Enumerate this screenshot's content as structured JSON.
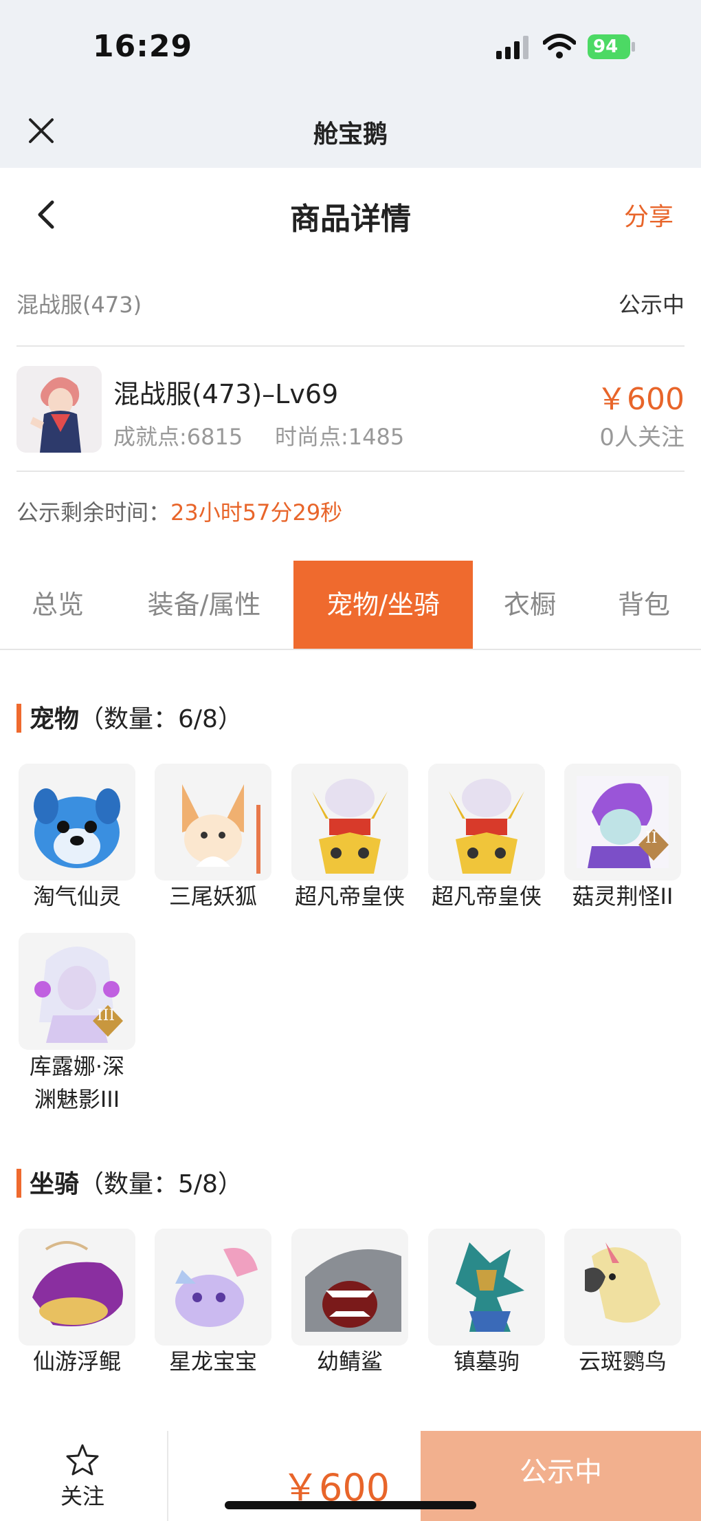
{
  "status_bar": {
    "time": "16:29",
    "battery": "94"
  },
  "app_header": {
    "title": "舱宝鹅"
  },
  "nav": {
    "title": "商品详情",
    "share_label": "分享"
  },
  "listing": {
    "server": "混战服(473)",
    "status": "公示中",
    "character_name": "混战服(473)–Lv69",
    "achievement": "成就点:6815",
    "fashion": "时尚点:1485",
    "price": "￥600",
    "watchers": "0人关注",
    "remaining_label": "公示剩余时间：",
    "remaining_value": "23小时57分29秒"
  },
  "tabs": [
    {
      "label": "总览",
      "active": false
    },
    {
      "label": "装备/属性",
      "active": false
    },
    {
      "label": "宠物/坐骑",
      "active": true
    },
    {
      "label": "衣橱",
      "active": false
    },
    {
      "label": "背包",
      "active": false
    }
  ],
  "pets": {
    "title": "宠物",
    "count": "（数量：6/8）",
    "items": [
      {
        "name": "淘气仙灵",
        "icon": "blue-dog-pet"
      },
      {
        "name": "三尾妖狐",
        "icon": "fox-pet"
      },
      {
        "name": "超凡帝皇侠",
        "icon": "gold-armor-pet"
      },
      {
        "name": "超凡帝皇侠",
        "icon": "gold-armor-pet"
      },
      {
        "name": "菇灵荆怪II",
        "icon": "purple-hair-pet",
        "badge": "II"
      },
      {
        "name": "库露娜·深渊魅影III",
        "line1": "库露娜·深",
        "line2": "渊魅影III",
        "icon": "white-hair-pet",
        "badge": "III"
      }
    ]
  },
  "mounts": {
    "title": "坐骑",
    "count": "（数量：5/8）",
    "items": [
      {
        "name": "仙游浮鲲",
        "icon": "whale-mount"
      },
      {
        "name": "星龙宝宝",
        "icon": "dragon-mount"
      },
      {
        "name": "幼鲭鲨",
        "icon": "shark-mount"
      },
      {
        "name": "镇墓驹",
        "icon": "armored-dragon-mount"
      },
      {
        "name": "云斑鹦鸟",
        "icon": "parrot-mount"
      }
    ]
  },
  "bottom_bar": {
    "follow_label": "关注",
    "price": "￥600",
    "cta_label": "公示中"
  },
  "colors": {
    "accent": "#ef6a2e",
    "price": "#e8652a",
    "cta_disabled": "#f2b08e"
  }
}
